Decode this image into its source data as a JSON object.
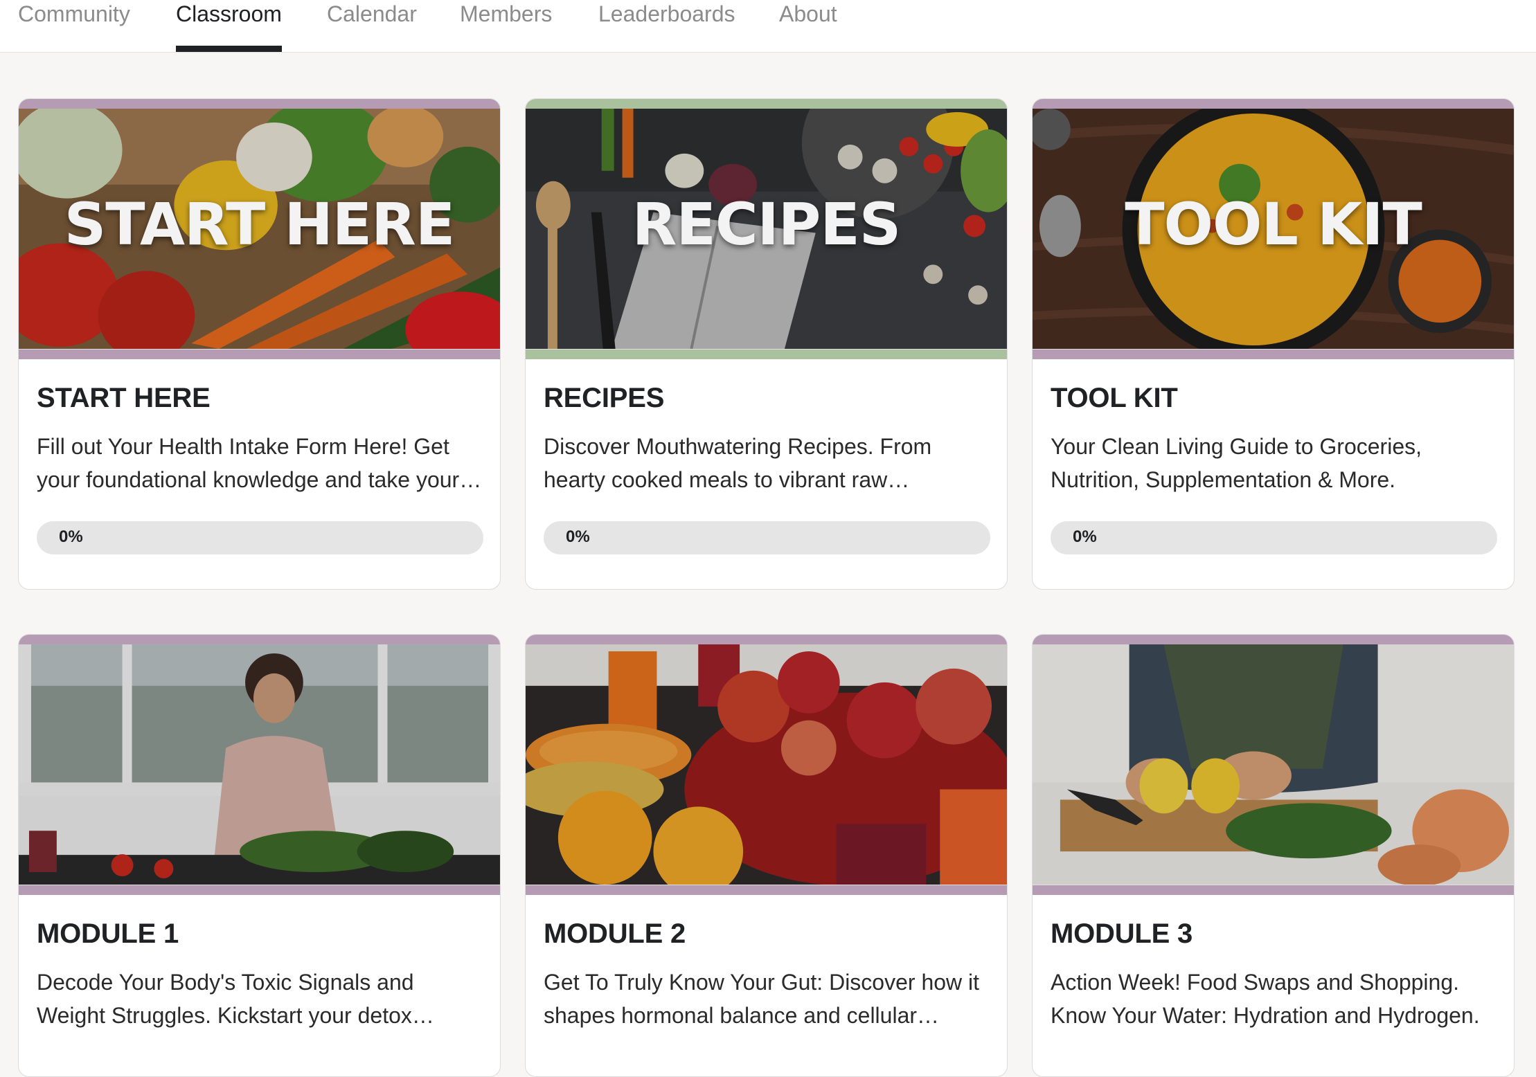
{
  "nav": {
    "tabs": [
      {
        "label": "Community",
        "active": false
      },
      {
        "label": "Classroom",
        "active": true
      },
      {
        "label": "Calendar",
        "active": false
      },
      {
        "label": "Members",
        "active": false
      },
      {
        "label": "Leaderboards",
        "active": false
      },
      {
        "label": "About",
        "active": false
      }
    ]
  },
  "courses": [
    {
      "overlay": "START HERE",
      "title": "START HERE",
      "description": "Fill out Your Health Intake Form Here! Get your foundational knowledge and take your…",
      "progress_label": "0%",
      "progress": 0
    },
    {
      "overlay": "RECIPES",
      "title": "RECIPES",
      "description": "Discover Mouthwatering Recipes. From hearty cooked meals to vibrant raw delights…",
      "progress_label": "0%",
      "progress": 0
    },
    {
      "overlay": "TOOL KIT",
      "title": "TOOL KIT",
      "description": "Your Clean Living Guide to Groceries, Nutrition, Supplementation & More.",
      "progress_label": "0%",
      "progress": 0
    },
    {
      "title": "MODULE 1",
      "description": "Decode Your Body's Toxic Signals and Weight Struggles. Kickstart your detox…"
    },
    {
      "title": "MODULE 2",
      "description": "Get To Truly Know Your Gut: Discover how it shapes hormonal balance and cellular…"
    },
    {
      "title": "MODULE 3",
      "description": "Action Week! Food Swaps and Shopping. Know Your Water: Hydration and Hydrogen."
    }
  ],
  "colors": {
    "accent_border_purple": "#b59bb4",
    "accent_border_green": "#a9c19c",
    "active_tab": "#202124",
    "inactive_tab": "#8b8b8b"
  }
}
